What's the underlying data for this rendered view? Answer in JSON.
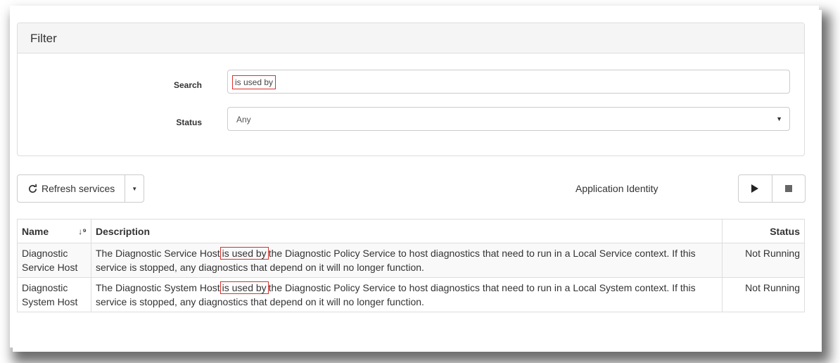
{
  "filter": {
    "heading": "Filter",
    "search_label": "Search",
    "search_value": "is used by",
    "status_label": "Status",
    "status_value": "Any"
  },
  "toolbar": {
    "refresh_label": "Refresh services",
    "app_identity_label": "Application Identity"
  },
  "table": {
    "headers": {
      "name": "Name",
      "description": "Description",
      "status": "Status"
    },
    "rows": [
      {
        "name": "Diagnostic Service Host",
        "desc_before": "The Diagnostic Service Host",
        "desc_highlight": "is used by",
        "desc_after": "the Diagnostic Policy Service to host diagnostics that need to run in a Local Service context. If this service is stopped, any diagnostics that depend on it will no longer function.",
        "status": "Not Running"
      },
      {
        "name": "Diagnostic System Host",
        "desc_before": "The Diagnostic System Host",
        "desc_highlight": "is used by",
        "desc_after": "the Diagnostic Policy Service to host diagnostics that need to run in a Local System context. If this service is stopped, any diagnostics that depend on it will no longer function.",
        "status": "Not Running"
      }
    ]
  },
  "colors": {
    "highlight": "#d9302b",
    "border": "#dddddd",
    "panel_heading_bg": "#f5f5f5"
  },
  "icons": {
    "refresh": "refresh-icon",
    "dropdown": "caret-down-icon",
    "sort": "sort-alpha-down-icon",
    "play": "play-icon",
    "stop": "stop-icon"
  }
}
